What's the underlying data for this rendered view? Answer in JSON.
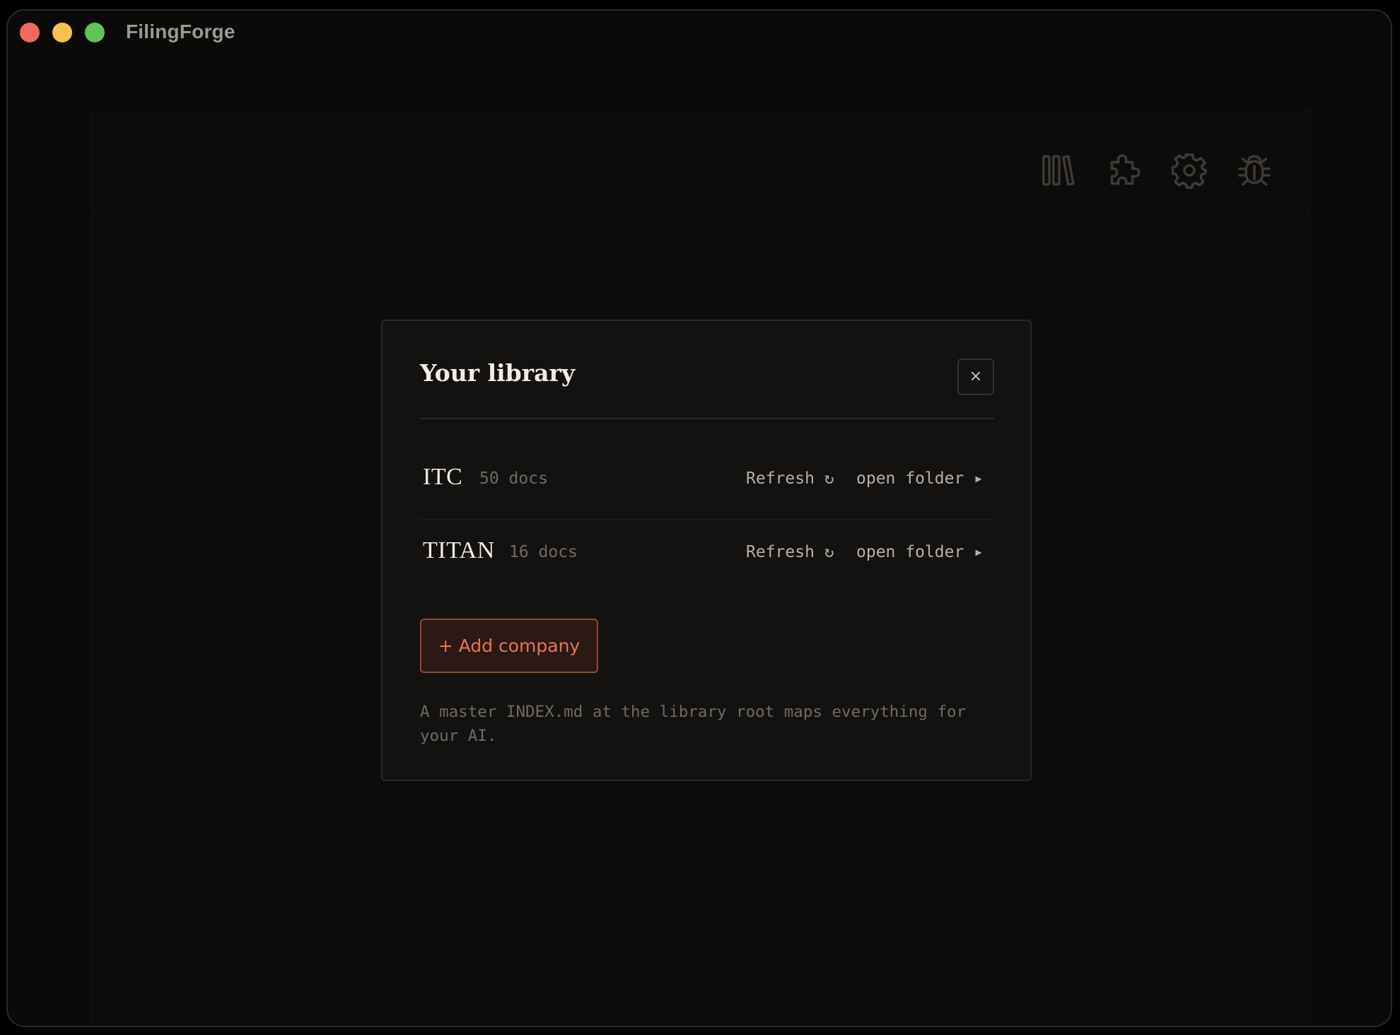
{
  "window": {
    "title": "FilingForge"
  },
  "toolbar": {
    "icons": [
      "library-icon",
      "puzzle-icon",
      "gear-icon",
      "bug-icon"
    ]
  },
  "modal": {
    "title": "Your library",
    "close_label": "×",
    "companies": [
      {
        "name": "ITC",
        "docs": "50 docs",
        "refresh": "Refresh ↻",
        "open": "open folder ▸"
      },
      {
        "name": "TITAN",
        "docs": "16 docs",
        "refresh": "Refresh ↻",
        "open": "open folder ▸"
      }
    ],
    "add_button": "+ Add company",
    "footnote": "A master INDEX.md at the library root maps everything for your AI."
  },
  "colors": {
    "background": "#0b0a09",
    "modal_bg": "#141211",
    "accent": "#e8744f",
    "text_primary": "#f1ece5",
    "text_muted": "#6d6964"
  }
}
